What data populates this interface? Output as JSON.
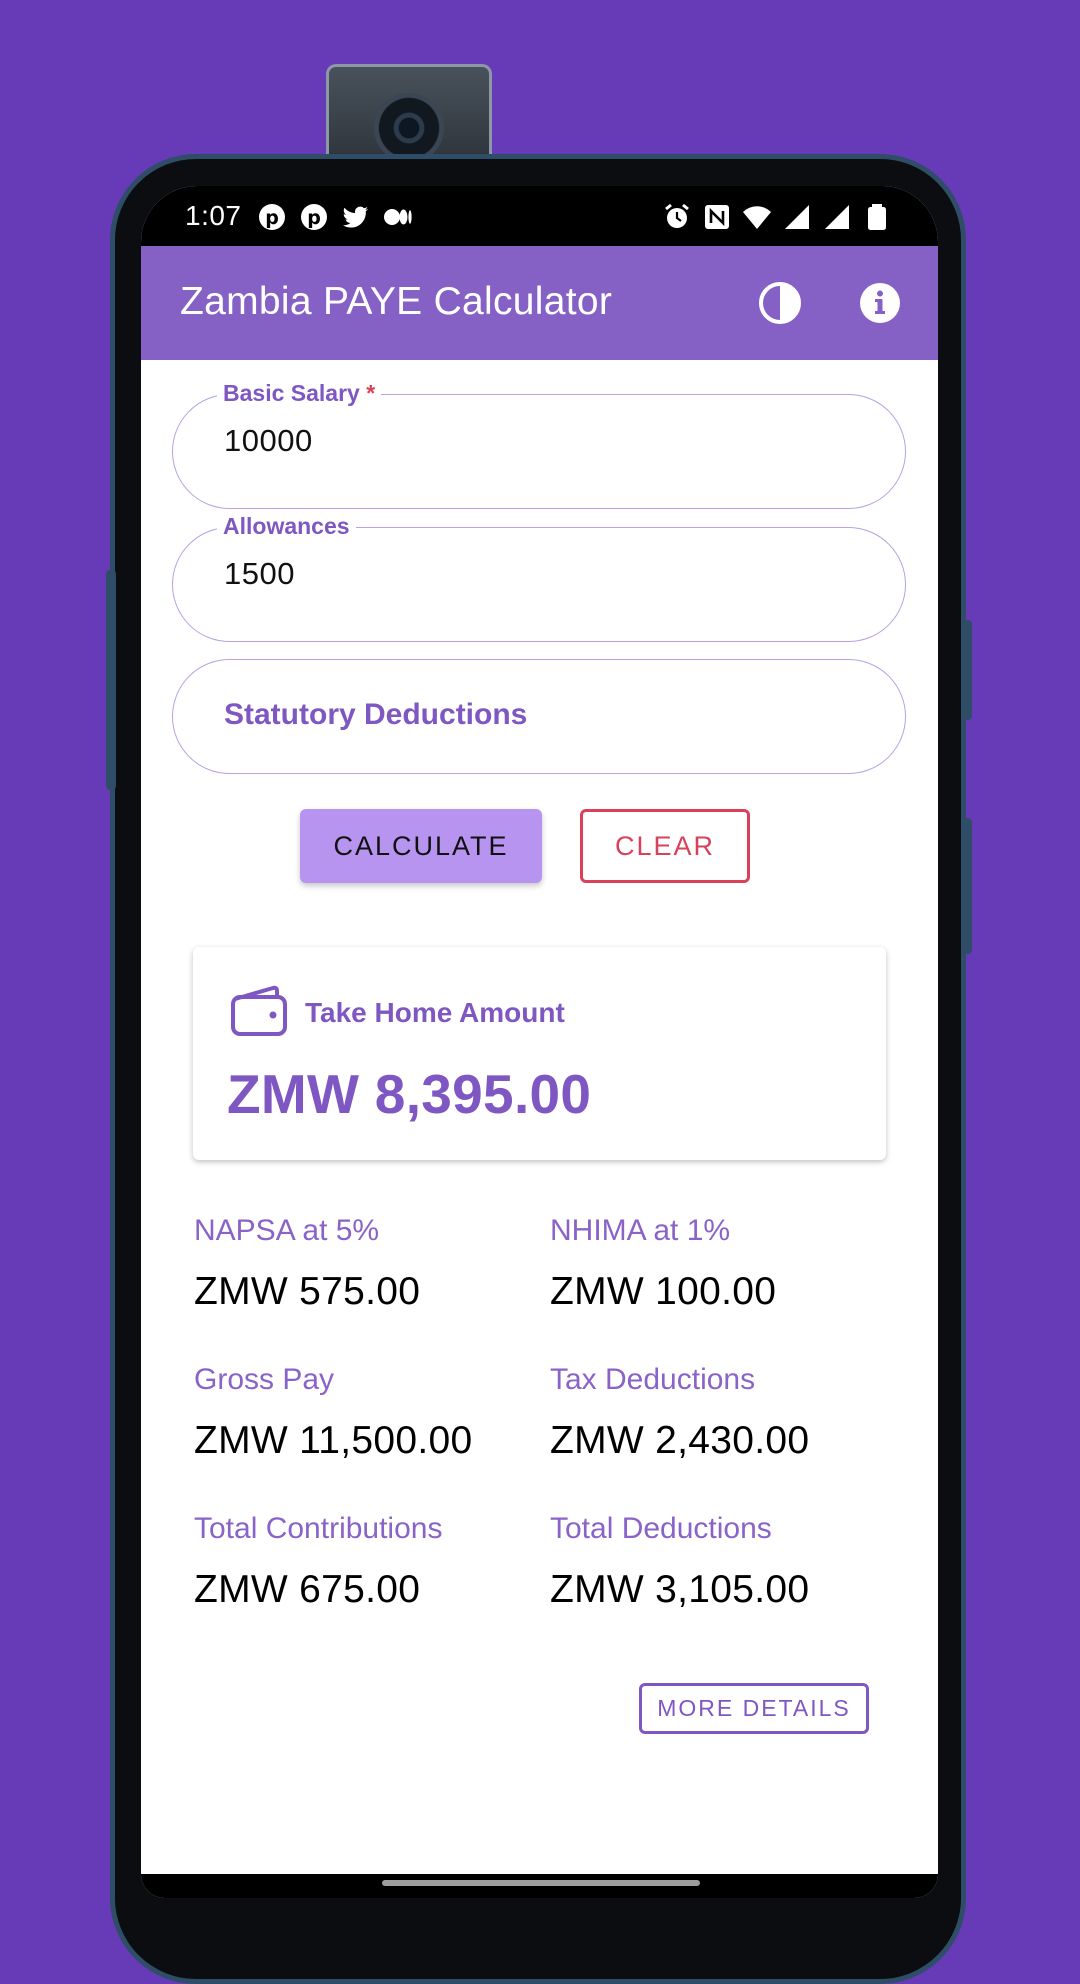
{
  "status_bar": {
    "time": "1:07",
    "left_icons": [
      "pinterest-icon",
      "pinterest-icon",
      "twitter-icon",
      "medium-icon"
    ],
    "right_icons": [
      "alarm-icon",
      "nfc-icon",
      "wifi-icon",
      "signal-icon",
      "signal-icon",
      "battery-icon"
    ]
  },
  "app_bar": {
    "title": "Zambia PAYE Calculator",
    "actions": [
      "theme-toggle-icon",
      "info-icon"
    ]
  },
  "form": {
    "basic_salary": {
      "label": "Basic Salary",
      "required_mark": "*",
      "value": "10000"
    },
    "allowances": {
      "label": "Allowances",
      "value": "1500"
    },
    "statutory_deductions": {
      "label": "Statutory Deductions"
    },
    "calculate_label": "CALCULATE",
    "clear_label": "CLEAR"
  },
  "result": {
    "take_home_label": "Take Home Amount",
    "take_home_value": "ZMW 8,395.00",
    "stats": [
      {
        "label": "NAPSA at 5%",
        "value": "ZMW 575.00"
      },
      {
        "label": "NHIMA at 1%",
        "value": "ZMW 100.00"
      },
      {
        "label": "Gross Pay",
        "value": "ZMW 11,500.00"
      },
      {
        "label": "Tax Deductions",
        "value": "ZMW 2,430.00"
      },
      {
        "label": "Total Contributions",
        "value": "ZMW 675.00"
      },
      {
        "label": "Total Deductions",
        "value": "ZMW 3,105.00"
      }
    ],
    "more_details_label": "MORE DETAILS"
  },
  "colors": {
    "background": "#673ab7",
    "app_bar": "#8561c5",
    "accent": "#7e57c2",
    "calculate_button": "#b794ef",
    "danger": "#d9415a"
  }
}
